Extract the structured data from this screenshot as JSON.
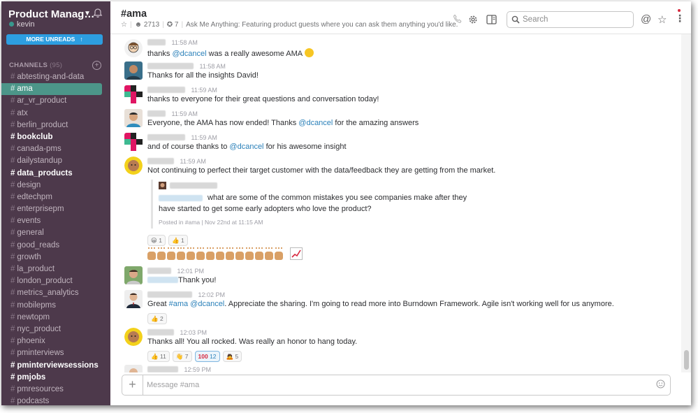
{
  "sidebar": {
    "team_name": "Product Manag…",
    "user_name": "kevin",
    "more_unreads_label": "MORE UNREADS",
    "channels_header": "CHANNELS",
    "channels_count": "(95)",
    "channels": [
      {
        "name": "abtesting-and-data",
        "state": "normal"
      },
      {
        "name": "ama",
        "state": "active"
      },
      {
        "name": "ar_vr_product",
        "state": "normal"
      },
      {
        "name": "atx",
        "state": "normal"
      },
      {
        "name": "berlin_product",
        "state": "normal"
      },
      {
        "name": "bookclub",
        "state": "unread"
      },
      {
        "name": "canada-pms",
        "state": "normal"
      },
      {
        "name": "dailystandup",
        "state": "normal"
      },
      {
        "name": "data_products",
        "state": "unread"
      },
      {
        "name": "design",
        "state": "normal"
      },
      {
        "name": "edtechpm",
        "state": "normal"
      },
      {
        "name": "enterprisepm",
        "state": "normal"
      },
      {
        "name": "events",
        "state": "normal"
      },
      {
        "name": "general",
        "state": "normal"
      },
      {
        "name": "good_reads",
        "state": "normal"
      },
      {
        "name": "growth",
        "state": "normal"
      },
      {
        "name": "la_product",
        "state": "normal"
      },
      {
        "name": "london_product",
        "state": "normal"
      },
      {
        "name": "metrics_analytics",
        "state": "normal"
      },
      {
        "name": "mobilepms",
        "state": "normal"
      },
      {
        "name": "newtopm",
        "state": "normal"
      },
      {
        "name": "nyc_product",
        "state": "normal"
      },
      {
        "name": "phoenix",
        "state": "normal"
      },
      {
        "name": "pminterviews",
        "state": "normal"
      },
      {
        "name": "pminterviewsessions",
        "state": "unread"
      },
      {
        "name": "pmjobs",
        "state": "unread"
      },
      {
        "name": "pmresources",
        "state": "normal"
      },
      {
        "name": "podcasts",
        "state": "normal"
      }
    ]
  },
  "header": {
    "channel_title": "#ama",
    "member_count": "2713",
    "pinned_count": "7",
    "topic": "Ask Me Anything: Featuring product guests where you can ask them anything you'd like.",
    "search_placeholder": "Search"
  },
  "messages": [
    {
      "time": "11:58 AM",
      "parts": [
        {
          "t": "thanks "
        },
        {
          "t": "@dcancel",
          "mention": true
        },
        {
          "t": " was a really awesome AMA "
        }
      ],
      "emoji": "slightly-smiling-face"
    },
    {
      "time": "11:58 AM",
      "parts": [
        {
          "t": "Thanks for all the insights David!"
        }
      ]
    },
    {
      "time": "11:59 AM",
      "parts": [
        {
          "t": "thanks to everyone for their great questions and conversation today!"
        }
      ]
    },
    {
      "time": "11:59 AM",
      "parts": [
        {
          "t": "Everyone, the AMA has now ended! Thanks "
        },
        {
          "t": "@dcancel",
          "mention": true
        },
        {
          "t": " for the amazing answers"
        }
      ]
    },
    {
      "time": "11:59 AM",
      "parts": [
        {
          "t": "and of course thanks to "
        },
        {
          "t": "@dcancel",
          "mention": true
        },
        {
          "t": " for his awesome insight"
        }
      ]
    },
    {
      "time": "11:59 AM",
      "parts": [
        {
          "t": "Not continuing to perfect their target customer with the data/feedback they are getting from the market."
        }
      ]
    },
    {
      "time": "12:01 PM",
      "parts": [
        {
          "t": "Thank you!"
        }
      ]
    },
    {
      "time": "12:02 PM",
      "parts": [
        {
          "t": "Great "
        },
        {
          "t": "#ama",
          "mention": true
        },
        {
          "t": " "
        },
        {
          "t": "@dcancel",
          "mention": true
        },
        {
          "t": ". Appreciate the sharing. I'm going to read more into Burndown Framework. Agile isn't working well for us anymore."
        }
      ]
    },
    {
      "time": "12:03 PM",
      "parts": [
        {
          "t": "Thanks all! You all rocked. Was really an honor to hang today."
        }
      ]
    },
    {
      "time": "12:59 PM",
      "parts": []
    }
  ],
  "attachment": {
    "line1": "what are some of the common mistakes you see companies make after they",
    "line2": "have started to get some early adopters who love the product?",
    "footer": "Posted in #ama | Nov 22nd at 11:15 AM"
  },
  "reactions": {
    "msg6": [
      {
        "emoji": "grinning-face",
        "count": "1"
      },
      {
        "emoji": "thumbs-up",
        "count": "1"
      }
    ],
    "msg8": [
      {
        "emoji": "thumbs-up",
        "count": "2"
      }
    ],
    "msg9": [
      {
        "emoji": "thumbs-up",
        "count": "11"
      },
      {
        "emoji": "wave",
        "count": "7"
      },
      {
        "emoji": "hundred",
        "count": "12"
      },
      {
        "emoji": "person-bowing",
        "count": "5"
      }
    ]
  },
  "composer": {
    "placeholder": "Message #ama"
  },
  "colors": {
    "sidebar_bg": "#4d394b",
    "active_channel": "#4c9689",
    "more_unreads": "#2d9ee0",
    "mention": "#2a80b9"
  }
}
